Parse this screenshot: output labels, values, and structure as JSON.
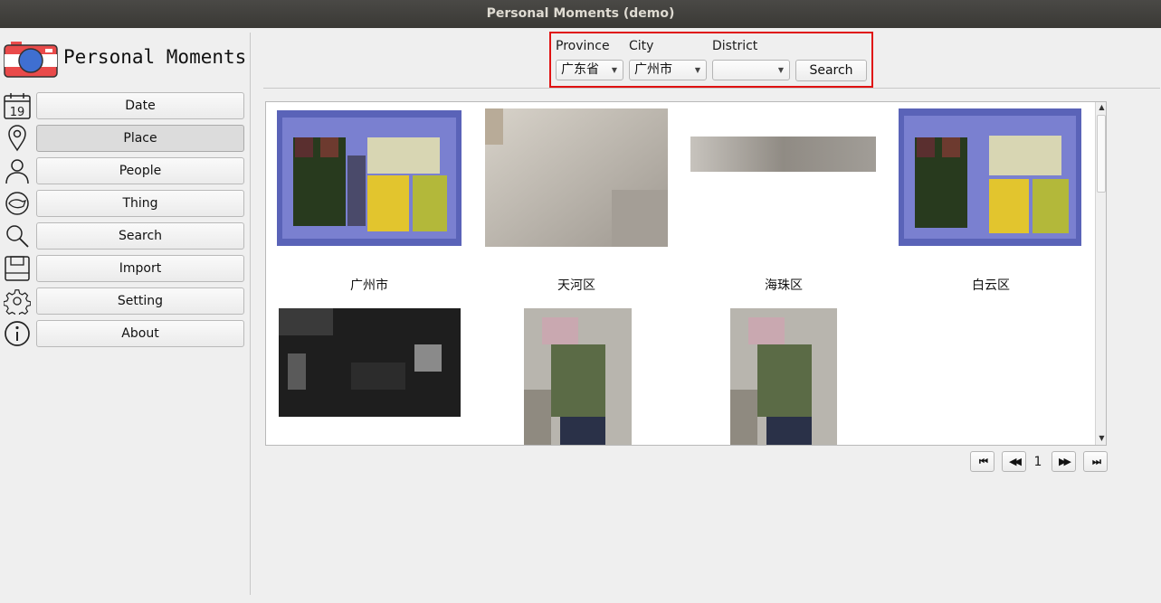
{
  "window": {
    "title": "Personal Moments (demo)"
  },
  "app": {
    "title": "Personal Moments"
  },
  "sidebar": {
    "items": [
      {
        "label": "Date",
        "icon": "calendar-icon",
        "icon_text": "19"
      },
      {
        "label": "Place",
        "icon": "location-pin-icon",
        "active": true
      },
      {
        "label": "People",
        "icon": "person-icon"
      },
      {
        "label": "Thing",
        "icon": "thing-icon"
      },
      {
        "label": "Search",
        "icon": "magnifier-icon"
      },
      {
        "label": "Import",
        "icon": "floppy-disk-icon"
      },
      {
        "label": "Setting",
        "icon": "gear-icon"
      },
      {
        "label": "About",
        "icon": "info-icon"
      }
    ]
  },
  "filters": {
    "province": {
      "label": "Province",
      "value": "广东省"
    },
    "city": {
      "label": "City",
      "value": "广州市"
    },
    "district": {
      "label": "District",
      "value": ""
    },
    "search_label": "Search",
    "highlight_color": "#e01212"
  },
  "gallery": {
    "groups": [
      {
        "label": "广州市"
      },
      {
        "label": "天河区"
      },
      {
        "label": "海珠区"
      },
      {
        "label": "白云区"
      }
    ]
  },
  "pagination": {
    "first": "⏮",
    "prev": "◀◀",
    "page": "1",
    "next": "▶▶",
    "last": "⏭"
  }
}
